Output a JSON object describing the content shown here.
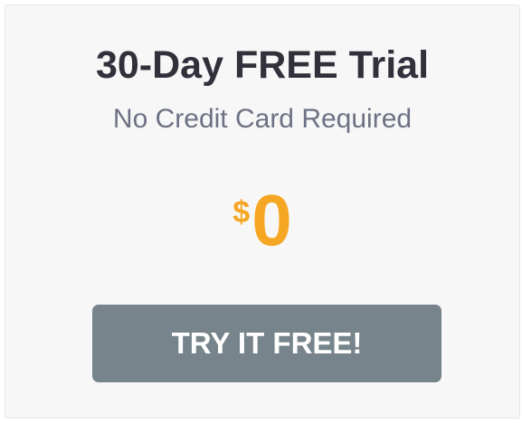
{
  "offer": {
    "title": "30-Day FREE Trial",
    "subtitle": "No Credit Card Required",
    "price": {
      "currency_symbol": "$",
      "amount": "0"
    },
    "cta_label": "TRY IT FREE!"
  },
  "colors": {
    "title": "#30313b",
    "subtitle": "#6d7183",
    "price": "#f5a623",
    "button": "#77848c",
    "card_background": "#f7f7f8"
  }
}
